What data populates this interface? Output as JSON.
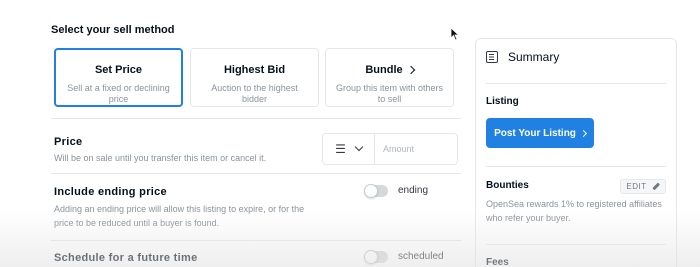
{
  "sell": {
    "title": "Select your sell method",
    "methods": [
      {
        "title": "Set Price",
        "desc": "Sell at a fixed or declining price",
        "active": true
      },
      {
        "title": "Highest Bid",
        "desc": "Auction to the highest bidder",
        "active": false
      },
      {
        "title": "Bundle",
        "desc": "Group this item with others to sell",
        "active": false,
        "chevron": true
      }
    ]
  },
  "price": {
    "title": "Price",
    "desc": "Will be on sale until you transfer this item or cancel it.",
    "currency_icon": "eth-icon",
    "amount_placeholder": "Amount"
  },
  "ending": {
    "title": "Include ending price",
    "desc": "Adding an ending price will allow this listing to expire, or for the price to be reduced until a buyer is found.",
    "toggle_label": "ending",
    "enabled": false
  },
  "schedule": {
    "title": "Schedule for a future time",
    "toggle_label": "scheduled",
    "enabled": false
  },
  "summary": {
    "title": "Summary",
    "listing_label": "Listing",
    "post_button": "Post Your Listing",
    "bounties_label": "Bounties",
    "edit_label": "EDIT",
    "bounties_desc": "OpenSea rewards 1% to registered affiliates who refer your buyer.",
    "fees_label": "Fees"
  },
  "colors": {
    "accent": "#2081e2",
    "text": "#04111d",
    "muted": "#8a939b",
    "border": "#e5e8eb"
  }
}
